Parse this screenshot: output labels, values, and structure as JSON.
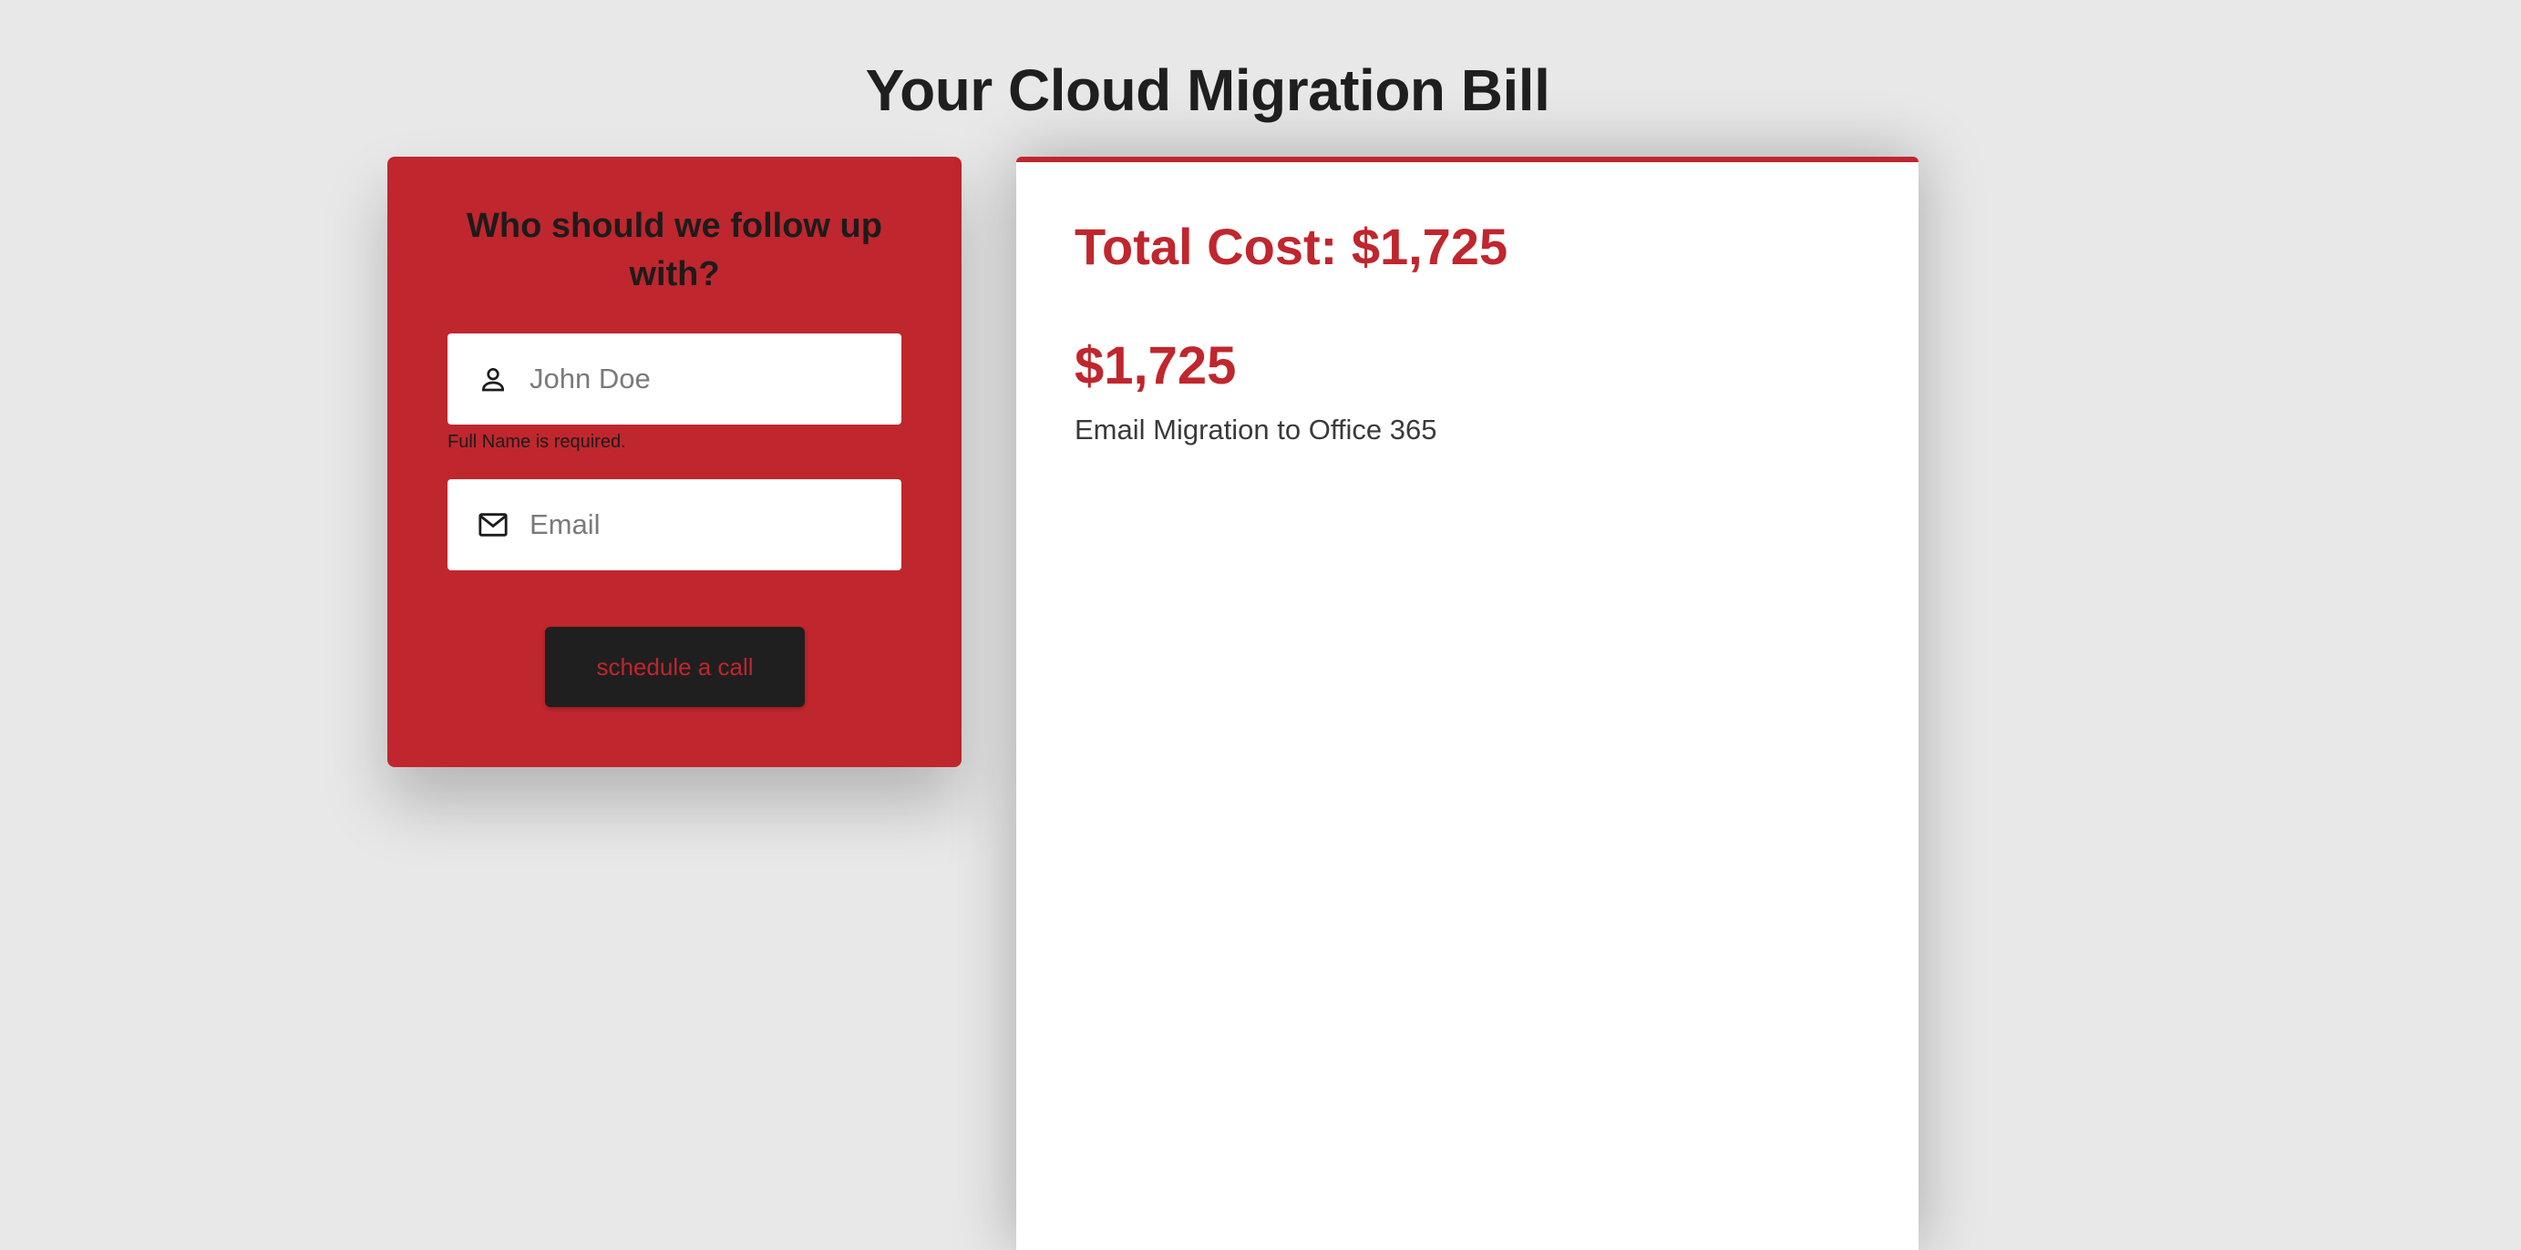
{
  "page": {
    "title": "Your Cloud Migration Bill"
  },
  "form": {
    "heading": "Who should we follow up with?",
    "name_field": {
      "placeholder": "John Doe",
      "value": "",
      "icon": "person-icon",
      "error": "Full Name is required."
    },
    "email_field": {
      "placeholder": "Email",
      "value": "",
      "icon": "mail-icon"
    },
    "submit_label": "schedule a call"
  },
  "bill": {
    "total_label": "Total Cost: $1,725",
    "items": [
      {
        "price": "$1,725",
        "description": "Email Migration to Office 365"
      }
    ]
  },
  "colors": {
    "accent": "#c0262d",
    "dark": "#1f1f1f",
    "background": "#e8e8e8"
  }
}
